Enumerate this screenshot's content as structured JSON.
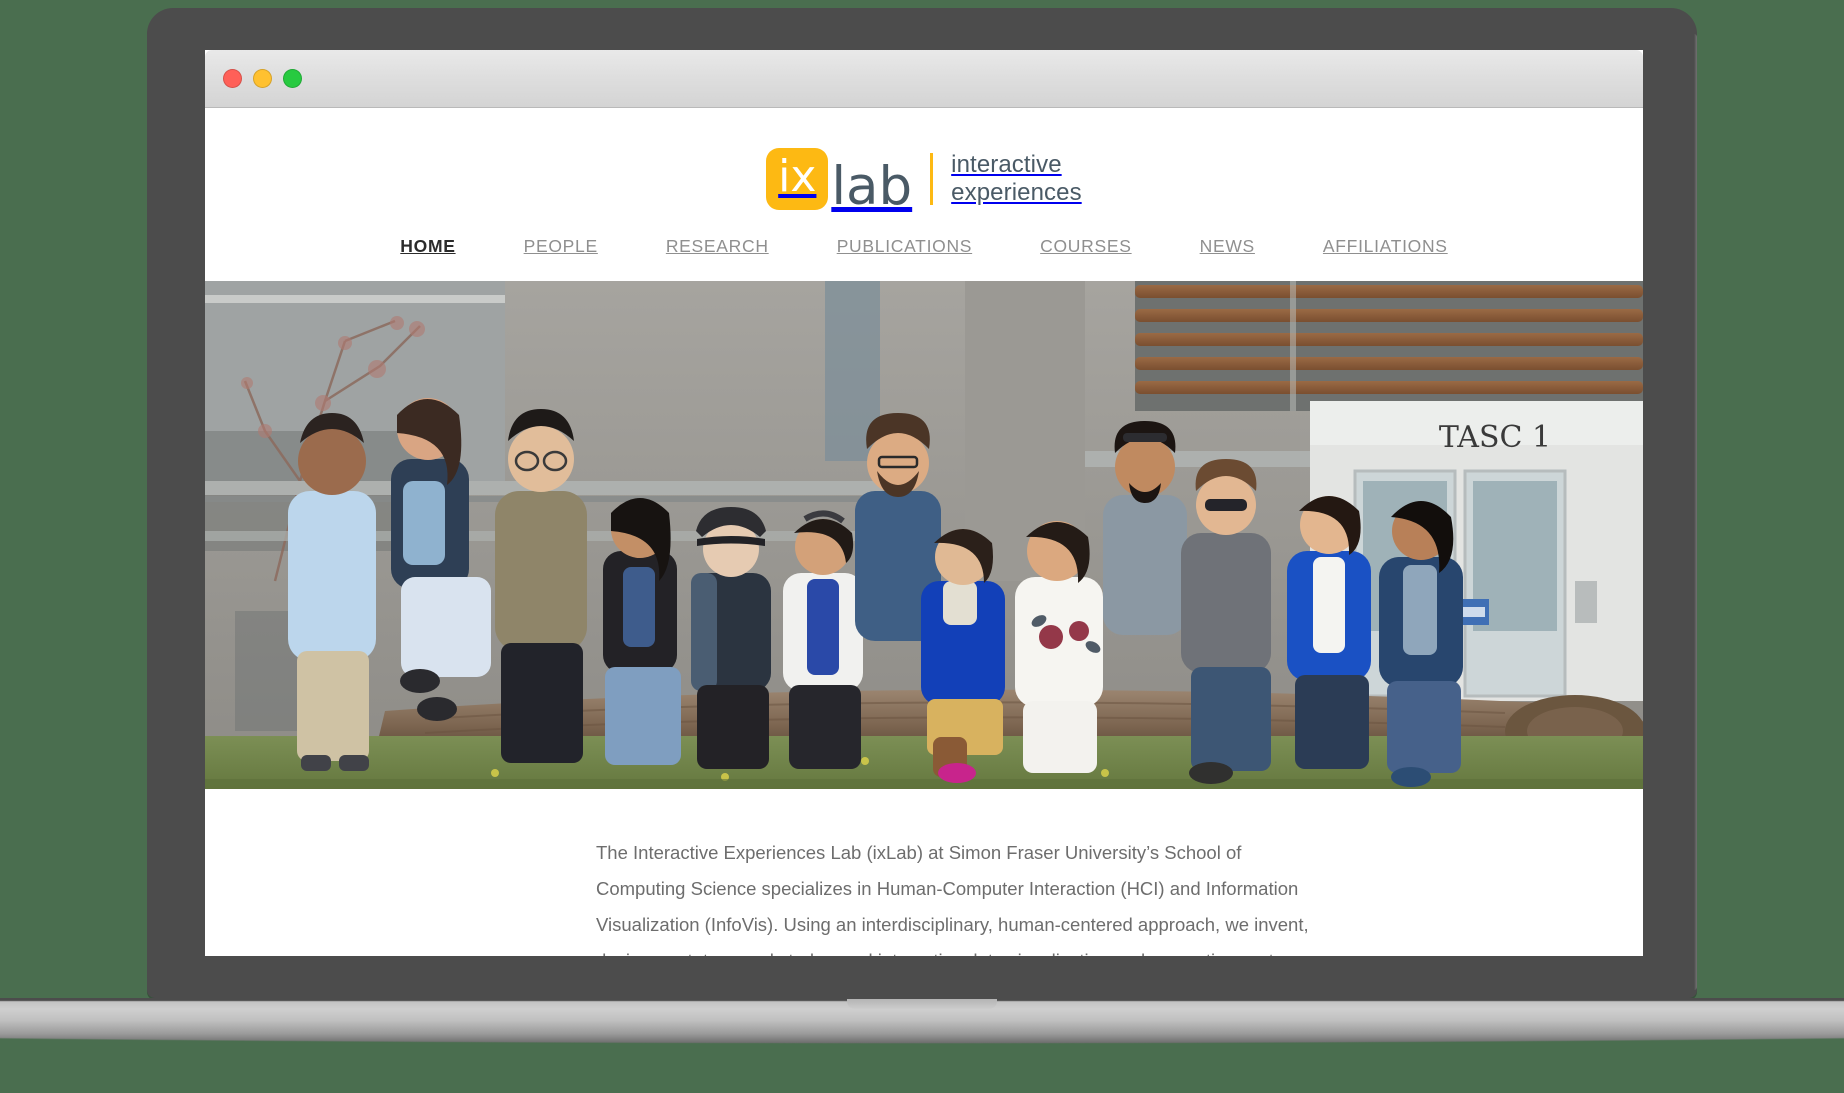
{
  "window": {
    "traffic_lights": [
      {
        "name": "close",
        "color": "#ff6058"
      },
      {
        "name": "minimize",
        "color": "#ffc130"
      },
      {
        "name": "zoom",
        "color": "#27ca40"
      }
    ]
  },
  "site": {
    "logo": {
      "tile_text": "ix",
      "word": "lab",
      "tagline_line1": "interactive",
      "tagline_line2": "experiences",
      "tile_color": "#fdb913",
      "word_color": "#4a5a66"
    },
    "nav": {
      "items": [
        {
          "label": "HOME",
          "active": true
        },
        {
          "label": "PEOPLE",
          "active": false
        },
        {
          "label": "RESEARCH",
          "active": false
        },
        {
          "label": "PUBLICATIONS",
          "active": false
        },
        {
          "label": "COURSES",
          "active": false
        },
        {
          "label": "NEWS",
          "active": false
        },
        {
          "label": "AFFILIATIONS",
          "active": false
        }
      ],
      "active_color": "#2b2b2b",
      "inactive_color": "#8f8f8f"
    },
    "hero": {
      "alt": "Group photo of the ixLab research team sitting on a large log outside the TASC 1 building",
      "building_sign": "TASC 1"
    },
    "intro": {
      "paragraph": "The Interactive Experiences Lab (ixLab) at Simon Fraser University’s School of Computing Science specializes in Human-Computer Interaction (HCI) and Information Visualization (InfoVis). Using an interdisciplinary, human-centered approach, we invent, design, prototype and study novel interactive data visualization and computing systems with the overt intention to empower people, helping to make it more possible for them to tackle technology and data challenges in a variety of domains.",
      "text_color": "#6d6d6d"
    }
  },
  "page_background": "#4a6e4f",
  "device": {
    "bezel_color": "#4c4c4c"
  }
}
